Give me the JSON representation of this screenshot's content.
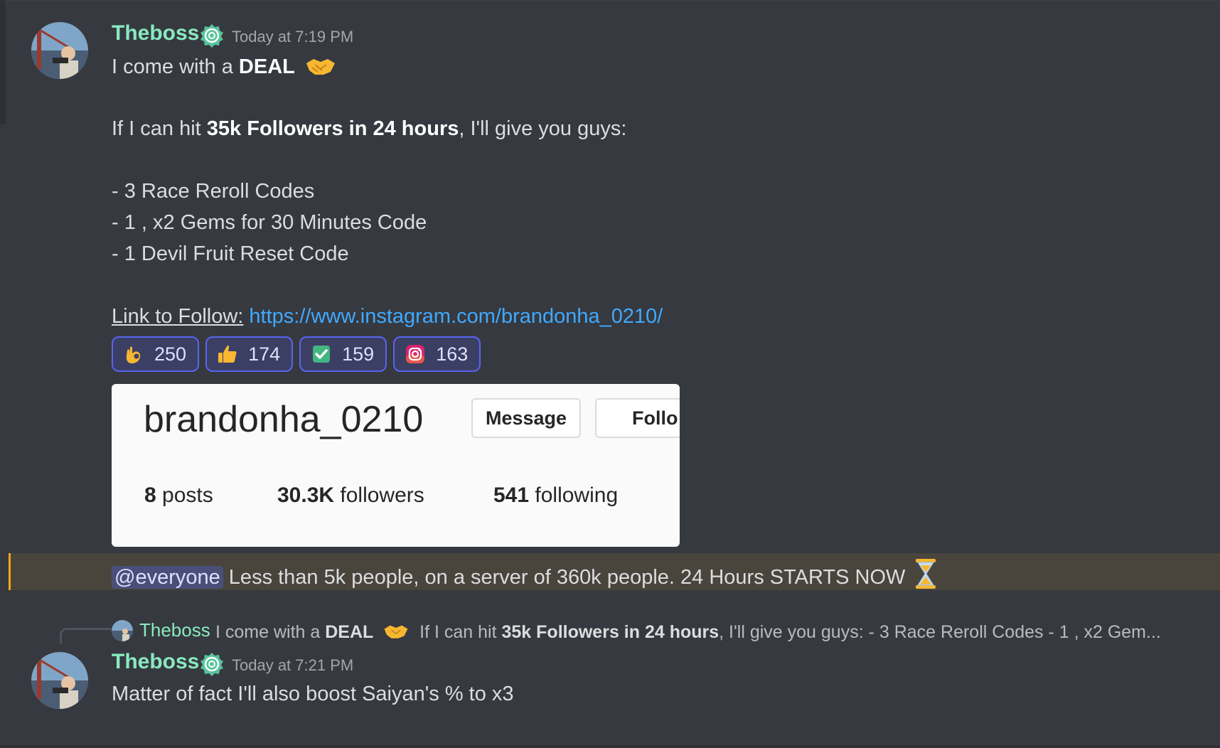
{
  "messages": [
    {
      "author": "Theboss",
      "timestamp": "Today at 7:19 PM",
      "line1": {
        "prefix": "I come with a ",
        "bold": "DEAL"
      },
      "line2": {
        "prefix": "If I can hit ",
        "bold": "35k Followers in 24 hours",
        "suffix": ", I'll give you guys:"
      },
      "list": [
        "- 3 Race Reroll Codes",
        "- 1 , x2 Gems for 30 Minutes Code",
        "- 1 Devil Fruit Reset Code"
      ],
      "link_label": "Link to Follow:",
      "link_url": "https://www.instagram.com/brandonha_0210/",
      "reactions": [
        {
          "icon": "ok-hand-icon",
          "count": "250"
        },
        {
          "icon": "thumbs-up-icon",
          "count": "174"
        },
        {
          "icon": "check-mark-icon",
          "count": "159"
        },
        {
          "icon": "instagram-icon",
          "count": "163"
        }
      ],
      "embed": {
        "username": "brandonha_0210",
        "message_button": "Message",
        "follow_button": "Follo",
        "posts_count": "8",
        "posts_label": " posts",
        "followers_count": "30.3K",
        "followers_label": " followers",
        "following_count": "541",
        "following_label": " following"
      },
      "announcement": {
        "mention": "@everyone",
        "text": " Less than 5k people, on a server of 360k people. 24 Hours STARTS NOW"
      }
    },
    {
      "author": "Theboss",
      "timestamp": "Today at 7:21 PM",
      "reply": {
        "author": "Theboss",
        "text1": "I come with a ",
        "bold1": "DEAL",
        "text2": "If I can hit ",
        "bold2": "35k Followers in 24 hours",
        "text3": ", I'll give you guys:  - 3 Race Reroll Codes - 1 , x2 Gem..."
      },
      "text": "Matter of fact I'll also boost Saiyan's % to x3"
    }
  ],
  "colors": {
    "background": "#36393f",
    "username": "#89e9bf",
    "link": "#40a9ff",
    "reaction_border": "#5865f2",
    "highlight_bar": "#faa61a"
  }
}
